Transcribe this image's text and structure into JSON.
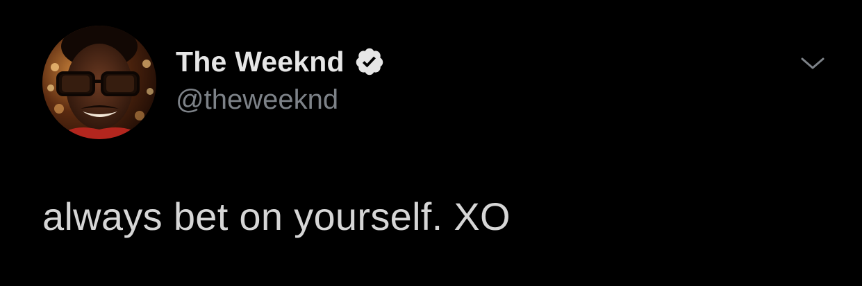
{
  "tweet": {
    "author": {
      "display_name": "The Weeknd",
      "handle": "@theweeknd",
      "verified_icon": "verified-badge-icon",
      "avatar": "profile-photo"
    },
    "text": "always bet on yourself. XO",
    "menu_icon": "chevron-down-icon"
  },
  "colors": {
    "background": "#000000",
    "name": "#e6e6e6",
    "handle": "#7d8288",
    "text": "#d6d6d6"
  }
}
